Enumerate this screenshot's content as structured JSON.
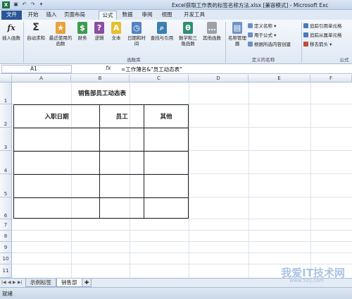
{
  "titlebar": {
    "app_icon": "X",
    "title": "Excel获取工作表的标签名称方法.xlsx [兼容模式] - Microsoft Exc",
    "qat": [
      "save-icon",
      "undo-icon",
      "redo-icon",
      "dropdown-icon"
    ]
  },
  "tabs": [
    "文件",
    "开始",
    "插入",
    "页面布局",
    "公式",
    "数据",
    "审阅",
    "视图",
    "开发工具"
  ],
  "ribbon": {
    "buttons": [
      {
        "label": "插入函数",
        "icon": "fx"
      },
      {
        "label": "自动求和",
        "icon": "Σ"
      },
      {
        "label": "最近使用的函数",
        "icon": "★"
      },
      {
        "label": "财务",
        "icon": "$"
      },
      {
        "label": "逻辑",
        "icon": "?"
      },
      {
        "label": "文本",
        "icon": "A"
      },
      {
        "label": "日期和时间",
        "icon": "◷"
      },
      {
        "label": "查找与引用",
        "icon": "⌕"
      },
      {
        "label": "数学和三角函数",
        "icon": "θ"
      },
      {
        "label": "其他函数",
        "icon": "…"
      },
      {
        "label": "名称管理器",
        "icon": "▤"
      }
    ],
    "group_function_library": "函数库",
    "group_defined_names": "定义的名称",
    "group_formula_auditing": "公式",
    "defined": [
      "定义名称 ▾",
      "用于公式 ▾",
      "根据所选内容创建"
    ],
    "auditing": [
      "追踪引用单元格",
      "追踪从属单元格",
      "移去箭头 ▾"
    ]
  },
  "formula_bar": {
    "name_box": "A1",
    "fx": "fx",
    "formula": "=工作薄名&\"员工动态表\""
  },
  "columns": [
    "A",
    "B",
    "C",
    "D",
    "E",
    "F"
  ],
  "rows": [
    "1",
    "2",
    "3",
    "4",
    "5",
    "6",
    "7",
    "8",
    "9",
    "10",
    "11"
  ],
  "table": {
    "title": "销售部员工动态表",
    "headers": [
      "入职日期",
      "员工",
      "其他"
    ]
  },
  "sheets": [
    "示例标签",
    "销售部"
  ],
  "status": "就绪",
  "watermark": "我爱IT技术网",
  "watermark_url": "www.52ij.com"
}
